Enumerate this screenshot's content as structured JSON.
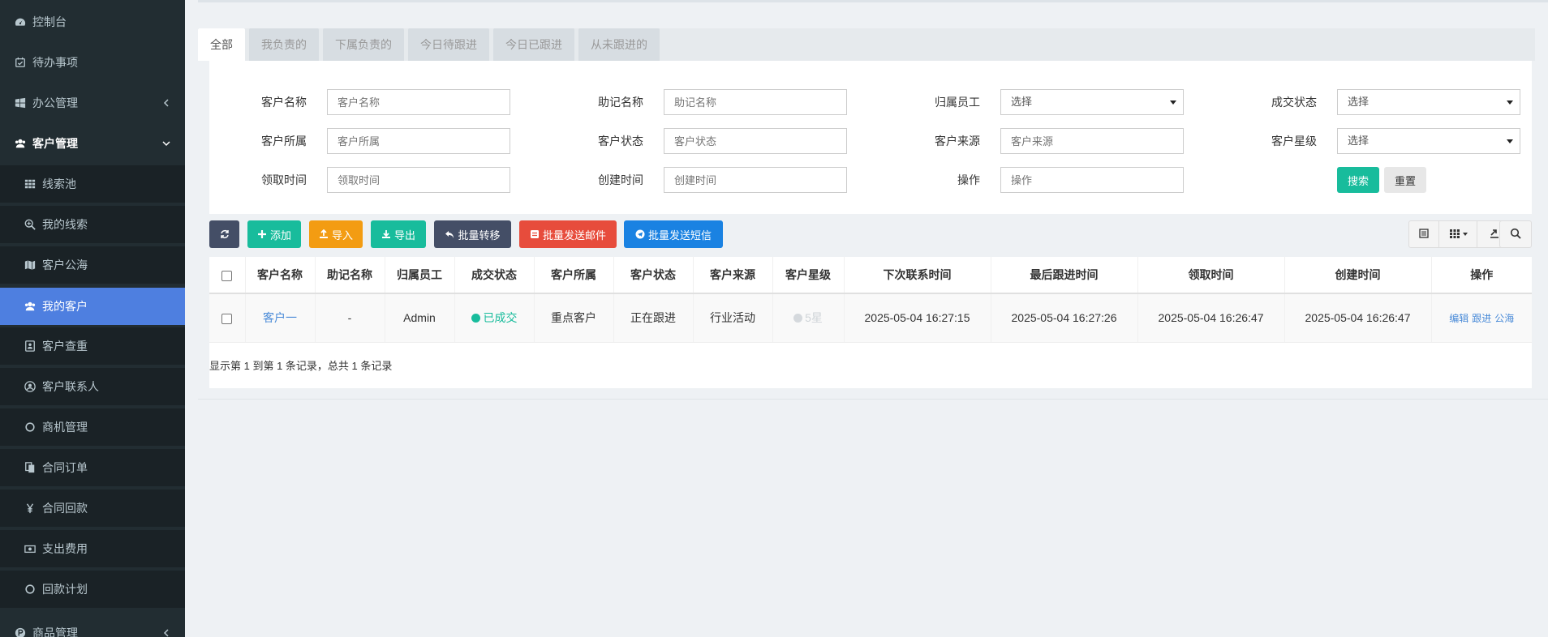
{
  "sidebar": {
    "items": [
      {
        "label": "控制台",
        "icon": "dashboard-icon"
      },
      {
        "label": "待办事项",
        "icon": "calendar-check-icon"
      },
      {
        "label": "办公管理",
        "icon": "windows-icon"
      },
      {
        "label": "客户管理",
        "icon": "users-icon"
      },
      {
        "label": "线索池",
        "icon": "grid-icon"
      },
      {
        "label": "我的线索",
        "icon": "search-plus-icon"
      },
      {
        "label": "客户公海",
        "icon": "map-icon"
      },
      {
        "label": "我的客户",
        "icon": "users-icon"
      },
      {
        "label": "客户查重",
        "icon": "address-book-icon"
      },
      {
        "label": "客户联系人",
        "icon": "user-circle-icon"
      },
      {
        "label": "商机管理",
        "icon": "circle-icon"
      },
      {
        "label": "合同订单",
        "icon": "copy-icon"
      },
      {
        "label": "合同回款",
        "icon": "yen-icon"
      },
      {
        "label": "支出费用",
        "icon": "money-icon"
      },
      {
        "label": "回款计划",
        "icon": "circle-icon"
      },
      {
        "label": "商品管理",
        "icon": "product-icon"
      }
    ]
  },
  "tabs": [
    "全部",
    "我负责的",
    "下属负责的",
    "今日待跟进",
    "今日已跟进",
    "从未跟进的"
  ],
  "filters": {
    "customer_name": {
      "label": "客户名称",
      "placeholder": "客户名称"
    },
    "mnemonic_name": {
      "label": "助记名称",
      "placeholder": "助记名称"
    },
    "owner": {
      "label": "归属员工",
      "value": "选择"
    },
    "deal_status": {
      "label": "成交状态",
      "value": "选择"
    },
    "customer_belong": {
      "label": "客户所属",
      "placeholder": "客户所属"
    },
    "customer_status": {
      "label": "客户状态",
      "placeholder": "客户状态"
    },
    "customer_source": {
      "label": "客户来源",
      "placeholder": "客户来源"
    },
    "customer_star": {
      "label": "客户星级",
      "value": "选择"
    },
    "receive_time": {
      "label": "领取时间",
      "placeholder": "领取时间"
    },
    "create_time": {
      "label": "创建时间",
      "placeholder": "创建时间"
    },
    "operation": {
      "label": "操作",
      "placeholder": "操作"
    },
    "search_label": "搜索",
    "reset_label": "重置"
  },
  "toolbar": {
    "add": "添加",
    "import": "导入",
    "export": "导出",
    "batch_transfer": "批量转移",
    "batch_email": "批量发送邮件",
    "batch_sms": "批量发送短信"
  },
  "table": {
    "headers": [
      "客户名称",
      "助记名称",
      "归属员工",
      "成交状态",
      "客户所属",
      "客户状态",
      "客户来源",
      "客户星级",
      "下次联系时间",
      "最后跟进时间",
      "领取时间",
      "创建时间",
      "操作"
    ],
    "rows": [
      {
        "name": "客户一",
        "mnemonic": "-",
        "owner": "Admin",
        "deal_status": "已成交",
        "belong": "重点客户",
        "status": "正在跟进",
        "source": "行业活动",
        "star": "5星",
        "next_contact": "2025-05-04 16:27:15",
        "last_follow": "2025-05-04 16:27:26",
        "receive_time": "2025-05-04 16:26:47",
        "create_time": "2025-05-04 16:26:47",
        "ops": [
          "编辑",
          "跟进",
          "公海"
        ]
      }
    ],
    "pagination": "显示第 1 到第 1 条记录，总共 1 条记录"
  },
  "colors": {
    "sidebar_bg": "#222d32",
    "active_nav": "#4e7fe0",
    "primary_green": "#18bc9c",
    "warning_orange": "#f39c12",
    "danger_red": "#e74c3c",
    "info_blue": "#3498db",
    "dark_navy": "#444e66"
  }
}
